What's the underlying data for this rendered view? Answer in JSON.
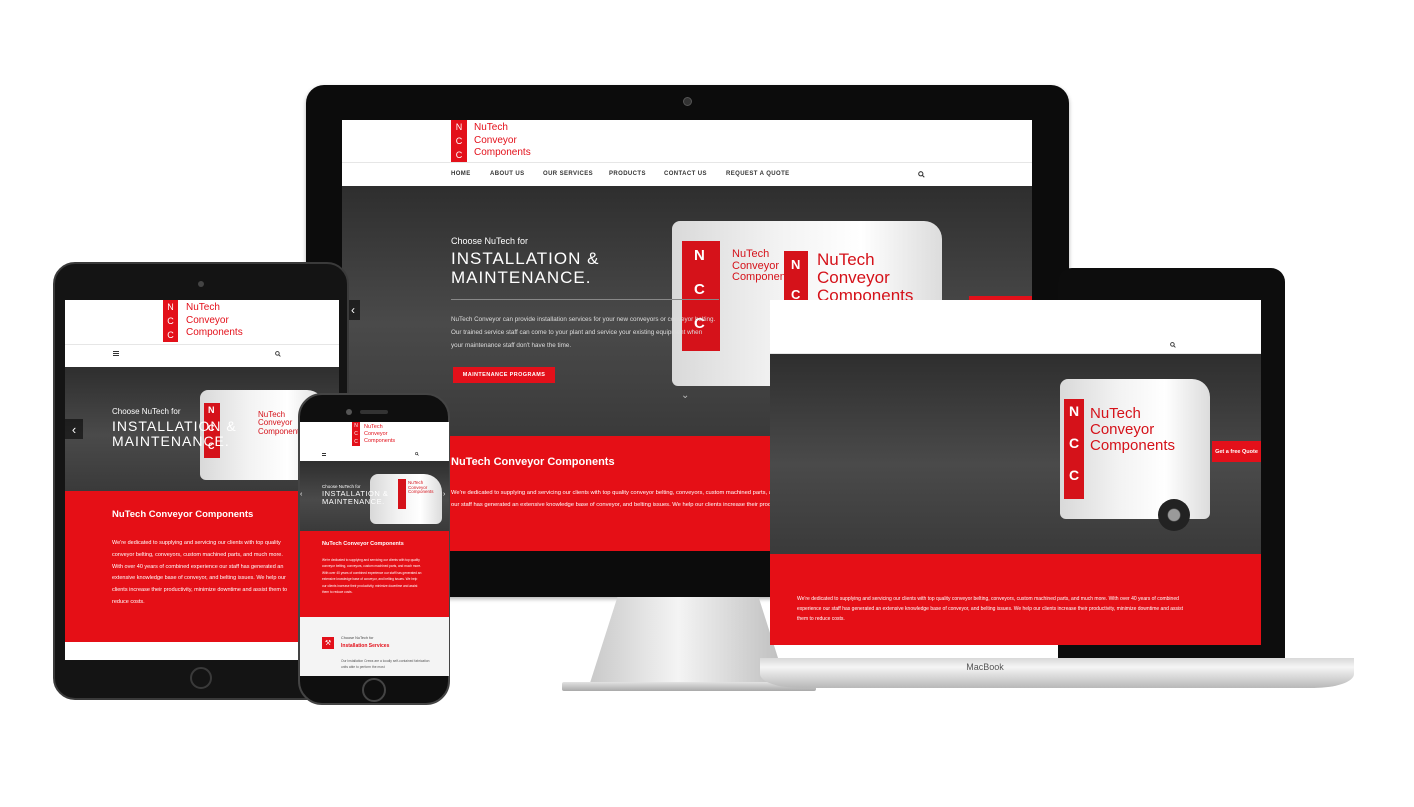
{
  "brand": {
    "initials": [
      "N",
      "C",
      "C"
    ],
    "name_lines": [
      "NuTech",
      "Conveyor",
      "Components"
    ],
    "accent": "#e3101a"
  },
  "nav": {
    "items": [
      "HOME",
      "ABOUT US",
      "OUR SERVICES",
      "PRODUCTS",
      "CONTACT US",
      "REQUEST A QUOTE"
    ],
    "search_icon": "search-icon",
    "menu_icon": "hamburger-icon"
  },
  "hero": {
    "kicker": "Choose NuTech for",
    "title_lines": [
      "INSTALLATION &",
      "MAINTENANCE."
    ],
    "body": "NuTech Conveyor can provide installation services for your new conveyors or conveyor belting. Our trained service staff can come to your plant and service your existing equipment when your maintenance staff don't have the time.",
    "cta": "MAINTENANCE PROGRAMS",
    "quote_button": "Get a free Quote",
    "prev_icon": "chevron-left-icon",
    "down_icon": "chevron-down-icon"
  },
  "about": {
    "title": "NuTech Conveyor Components",
    "body": "We're dedicated to supplying and servicing our clients with top quality conveyor belting, conveyors, custom machined parts, and much more. With over 40 years of combined experience our staff has generated an extensive knowledge base of conveyor, and belting issues. We help our clients increase their productivity, minimize downtime and assist them to reduce costs."
  },
  "services": {
    "kicker": "Choose NuTech for",
    "title": "Installation Services",
    "body": "Our Installation Crews are a locally self-contained fabrication units able to perform the most",
    "icon": "wrench-icon"
  },
  "devices": {
    "laptop_label": "MacBook"
  }
}
